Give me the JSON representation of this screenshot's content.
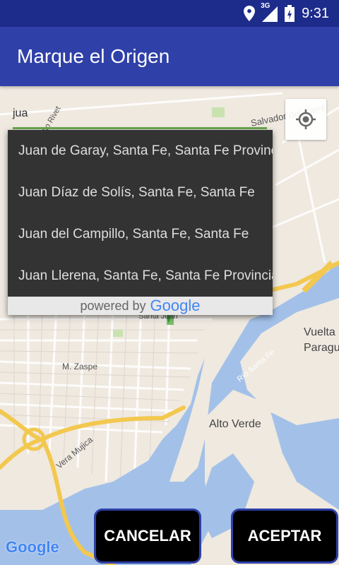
{
  "status_bar": {
    "network": "3G",
    "time": "9:31"
  },
  "app_bar": {
    "title": "Marque el Origen"
  },
  "search": {
    "value": "jua"
  },
  "suggestions": [
    "Juan de Garay, Santa Fe, Santa Fe Provincia",
    "Juan Díaz de Solís, Santa Fe, Santa Fe",
    "Juan del Campillo, Santa Fe, Santa Fe",
    "Juan Llerena, Santa Fe, Santa Fe Provincia"
  ],
  "powered_by": {
    "prefix": "powered by",
    "brand": "Google"
  },
  "map_labels": {
    "street1": "Salvador del Carril",
    "street2": "M. Zaspe",
    "street3": "Vera Mujica",
    "river": "Río Santa Fe",
    "place1": "Alto Verde",
    "place2_line1": "Vuelta",
    "place2_line2": "Paragu",
    "street4": "Santa Juan",
    "river_top": "Alto Rivet"
  },
  "buttons": {
    "cancel": "CANCELAR",
    "accept": "ACEPTAR"
  },
  "map_logo": "Google",
  "colors": {
    "status_bar": "#1d2b8a",
    "app_bar": "#2f40a8",
    "water": "#a3c1e8",
    "land": "#efe9e0",
    "highway": "#f3c84f"
  }
}
